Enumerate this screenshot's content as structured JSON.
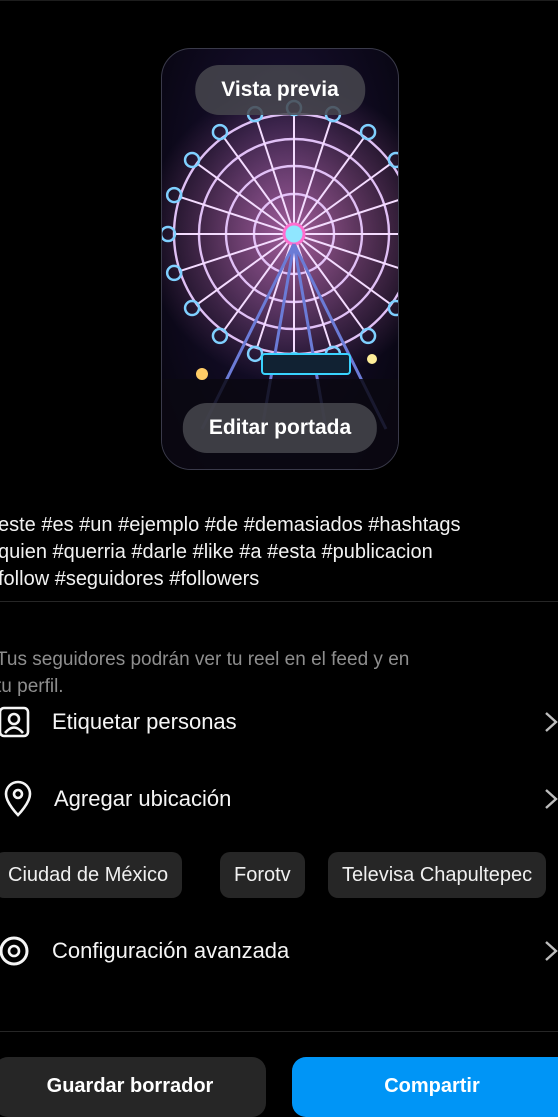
{
  "preview": {
    "preview_label": "Vista previa",
    "edit_cover_label": "Editar portada"
  },
  "caption": "este #es #un #ejemplo #de #demasiados #hashtags\nquien #querria #darle #like #a #esta #publicacion\nfollow #seguidores #followers",
  "info_text": "Tus seguidores podrán ver tu reel en el feed y en\ntu perfil.",
  "options": {
    "tag_people": "Etiquetar personas",
    "add_location": "Agregar ubicación",
    "advanced_settings": "Configuración avanzada"
  },
  "location_suggestions": [
    "Ciudad de México",
    "Forotv",
    "Televisa Chapultepec"
  ],
  "actions": {
    "save_draft": "Guardar borrador",
    "share": "Compartir"
  },
  "colors": {
    "accent": "#0095f6",
    "chip_bg": "#262626",
    "background": "#000000"
  }
}
